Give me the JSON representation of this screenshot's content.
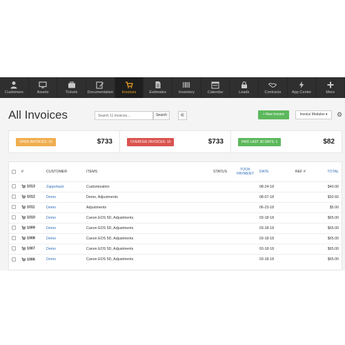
{
  "nav": {
    "items": [
      {
        "label": "Customers",
        "icon": "person-icon"
      },
      {
        "label": "Assets",
        "icon": "monitor-icon"
      },
      {
        "label": "Tickets",
        "icon": "briefcase-icon"
      },
      {
        "label": "Documentation",
        "icon": "edit-icon"
      },
      {
        "label": "Invoices",
        "icon": "cart-icon",
        "active": true
      },
      {
        "label": "Estimates",
        "icon": "document-icon"
      },
      {
        "label": "Inventory",
        "icon": "barcode-icon"
      },
      {
        "label": "Calendar",
        "icon": "calendar-icon"
      },
      {
        "label": "Leads",
        "icon": "lock-icon"
      },
      {
        "label": "Contracts",
        "icon": "handshake-icon"
      },
      {
        "label": "App Center",
        "icon": "bolt-icon"
      },
      {
        "label": "More",
        "icon": "plus-icon"
      }
    ]
  },
  "header": {
    "title": "All Invoices",
    "search_placeholder": "Search 11 Invoices...",
    "search_button": "Search",
    "new_button": "+ New Invoice",
    "modules_button": "Invoice Modules ▾"
  },
  "summary": {
    "open_label": "OPEN INVOICES: 10",
    "open_amount": "$733",
    "overdue_label": "OVERDUE INVOICES: 10",
    "overdue_amount": "$733",
    "paid_label": "PAID LAST 30 DAYS: 1",
    "paid_amount": "$82"
  },
  "table": {
    "headers": {
      "num": "#",
      "customer": "CUSTOMER",
      "items": "ITEMS",
      "status": "STATUS",
      "took_payment": "TOOK PAYMENT",
      "date": "DATE",
      "ref": "REF #",
      "total": "TOTAL"
    },
    "rows": [
      {
        "num": "1013",
        "customer": "Zappshack",
        "items": "Customization",
        "date": "08-24-18",
        "total": "$40.00"
      },
      {
        "num": "1012",
        "customer": "Demo",
        "items": "Demo, Adjustments",
        "date": "08-07-18",
        "total": "$92.60"
      },
      {
        "num": "1011",
        "customer": "Demo",
        "items": "Adjustments",
        "date": "06-23-18",
        "total": "$5.00"
      },
      {
        "num": "1010",
        "customer": "Demo",
        "items": "Canon EOS 5D, Adjustments",
        "date": "03-18-18",
        "total": "$65.00"
      },
      {
        "num": "1009",
        "customer": "Demo",
        "items": "Canon EOS 5D, Adjustments",
        "date": "03-18-18",
        "total": "$65.00"
      },
      {
        "num": "1008",
        "customer": "Demo",
        "items": "Canon EOS 5D, Adjustments",
        "date": "03-18-18",
        "total": "$65.00"
      },
      {
        "num": "1007",
        "customer": "Demo",
        "items": "Canon EOS 5D, Adjustments",
        "date": "03-18-18",
        "total": "$65.00"
      },
      {
        "num": "1006",
        "customer": "Demo",
        "items": "Canon EOS 5D, Adjustments",
        "date": "03-18-18",
        "total": "$65.00"
      }
    ]
  }
}
